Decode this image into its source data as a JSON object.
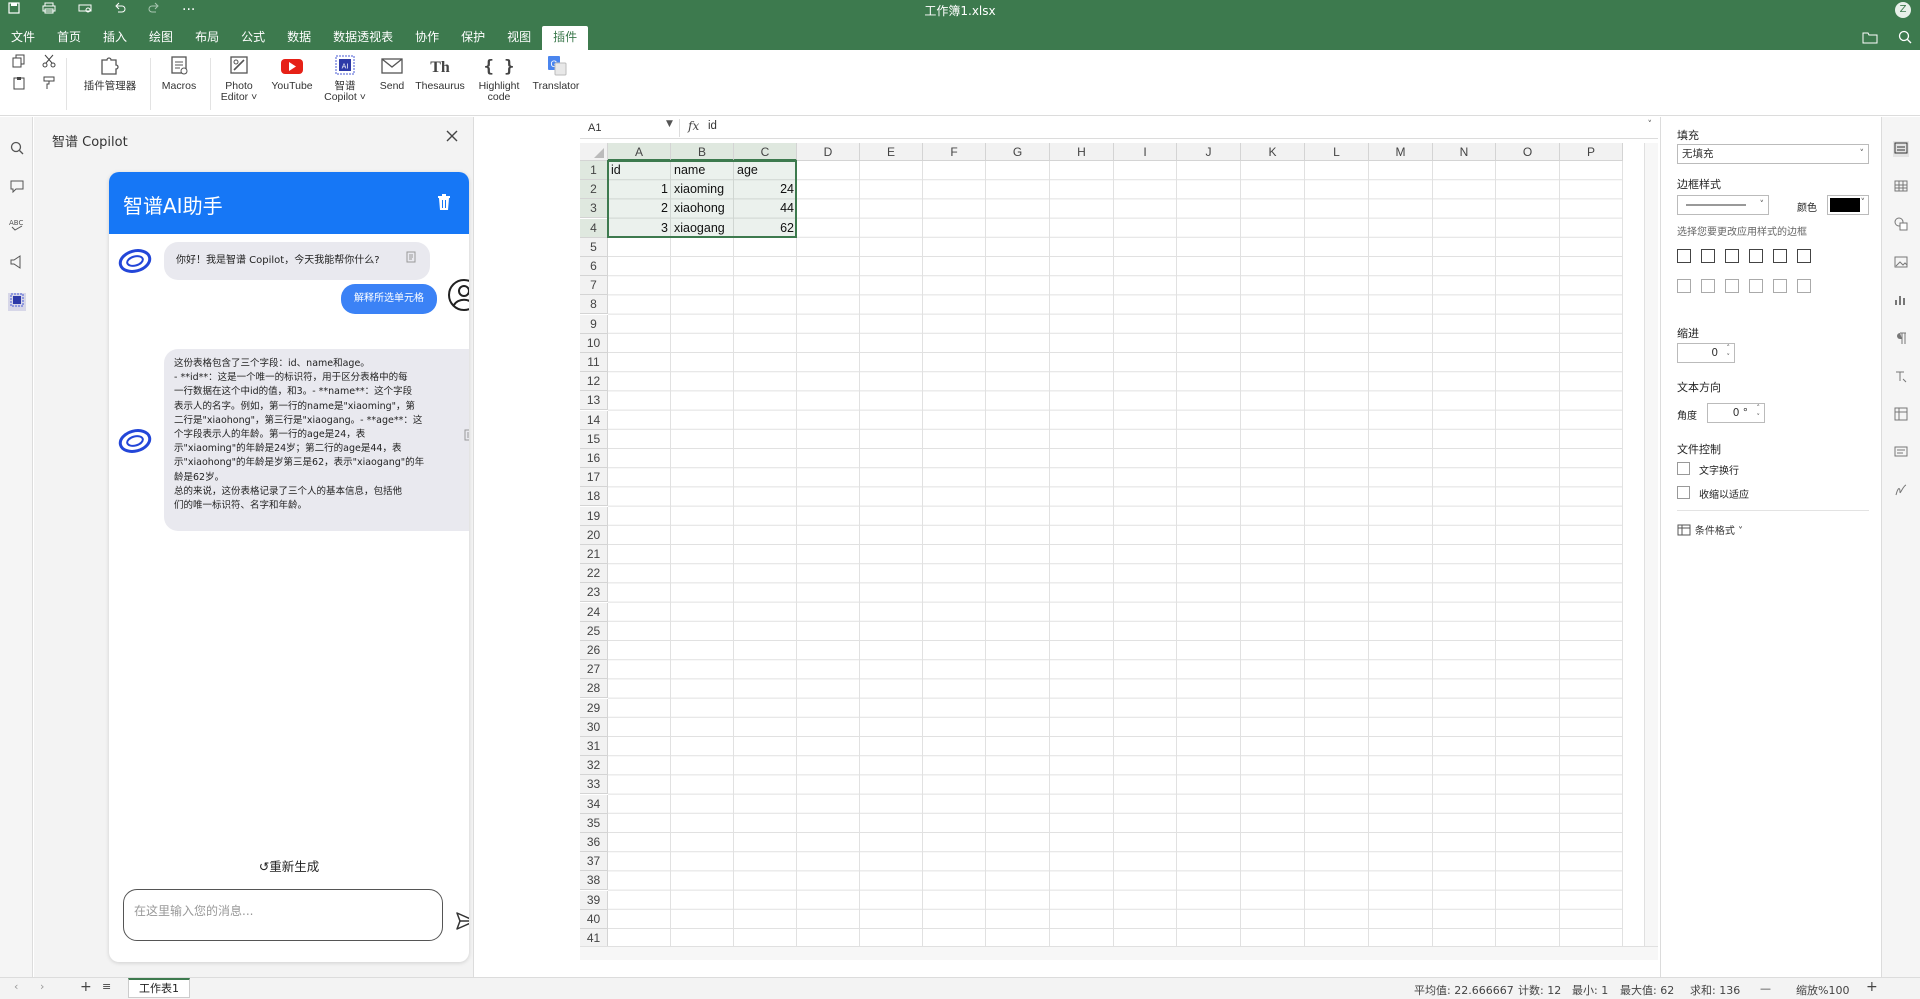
{
  "app": {
    "doc_title": "工作簿1.xlsx",
    "user_initial": "Z",
    "quick_access": [
      "save-icon",
      "print-icon",
      "print-preview-icon",
      "undo-icon",
      "redo-icon",
      "more-icon"
    ],
    "more_label": "···"
  },
  "menu": {
    "items": [
      "文件",
      "首页",
      "插入",
      "绘图",
      "布局",
      "公式",
      "数据",
      "数据透视表",
      "协作",
      "保护",
      "视图",
      "插件"
    ],
    "active": "插件"
  },
  "ribbon": {
    "buttons": [
      {
        "label1": "插件管理器",
        "label2": "",
        "icon": "puzzle-icon"
      },
      {
        "label1": "Macros",
        "label2": "",
        "icon": "macros-icon"
      },
      {
        "label1": "Photo",
        "label2": "Editor ˅",
        "icon": "photo-editor-icon"
      },
      {
        "label1": "YouTube",
        "label2": "",
        "icon": "youtube-icon"
      },
      {
        "label1": "智谱",
        "label2": "Copilot ˅",
        "icon": "ai-chip-icon"
      },
      {
        "label1": "Send",
        "label2": "",
        "icon": "envelope-icon"
      },
      {
        "label1": "Thesaurus",
        "label2": "",
        "icon": "thesaurus-icon"
      },
      {
        "label1": "Highlight",
        "label2": "code",
        "icon": "braces-icon"
      },
      {
        "label1": "Translator",
        "label2": "",
        "icon": "translator-icon"
      }
    ],
    "thesaurus_glyph": "Th",
    "braces_glyph": "{ }",
    "ai_glyph": "AI"
  },
  "copilot": {
    "panel_title": "智谱 Copilot",
    "header_title": "智谱AI助手",
    "greeting": "你好！我是智谱 Copilot，今天我能帮你什么?",
    "user_message": "解释所选单元格",
    "answer": "这份表格包含了三个字段：id、name和age。\n- **id**：这是一个唯一的标识符，用于区分表格中的每\n一行数据在这个中id的值，和3。- **name**：这个字段\n表示人的名字。例如，第一行的name是\"xiaoming\"，第\n二行是\"xiaohong\"，第三行是\"xiaogang。- **age**：这\n个字段表示人的年龄。第一行的age是24，表\n示\"xiaoming\"的年龄是24岁；第二行的age是44，表\n示\"xiaohong\"的年龄是岁第三是62，表示\"xiaogang\"的年\n龄是62岁。\n总的来说，这份表格记录了三个人的基本信息，包括他\n们的唯一标识符、名字和年龄。",
    "regenerate": "↺重新生成",
    "input_placeholder": "在这里输入您的消息..."
  },
  "formula_bar": {
    "cell_ref": "A1",
    "fx_label": "fx",
    "value": "id"
  },
  "sheet": {
    "columns": [
      "A",
      "B",
      "C",
      "D",
      "E",
      "F",
      "G",
      "H",
      "I",
      "J",
      "K",
      "L",
      "M",
      "N",
      "O",
      "P"
    ],
    "row_count": 42,
    "selected_columns": [
      "A",
      "B",
      "C"
    ],
    "selected_rows": [
      1,
      2,
      3,
      4
    ],
    "cells": [
      {
        "row": 1,
        "col": 0,
        "value": "id",
        "num": false
      },
      {
        "row": 1,
        "col": 1,
        "value": "name",
        "num": false
      },
      {
        "row": 1,
        "col": 2,
        "value": "age",
        "num": false
      },
      {
        "row": 2,
        "col": 0,
        "value": "1",
        "num": true
      },
      {
        "row": 2,
        "col": 1,
        "value": "xiaoming",
        "num": false
      },
      {
        "row": 2,
        "col": 2,
        "value": "24",
        "num": true
      },
      {
        "row": 3,
        "col": 0,
        "value": "2",
        "num": true
      },
      {
        "row": 3,
        "col": 1,
        "value": "xiaohong",
        "num": false
      },
      {
        "row": 3,
        "col": 2,
        "value": "44",
        "num": true
      },
      {
        "row": 4,
        "col": 0,
        "value": "3",
        "num": true
      },
      {
        "row": 4,
        "col": 1,
        "value": "xiaogang",
        "num": false
      },
      {
        "row": 4,
        "col": 2,
        "value": "62",
        "num": true
      }
    ]
  },
  "format_panel": {
    "fill_label": "填充",
    "fill_value": "无填充",
    "border_style_label": "边框样式",
    "color_label": "颜色",
    "border_color": "#000000",
    "border_hint": "选择您要更改应用样式的边框",
    "indent_label": "缩进",
    "indent_value": "0",
    "text_dir_label": "文本方向",
    "angle_label": "角度",
    "angle_value": "0 °",
    "text_control_label": "文件控制",
    "wrap_label": "文字换行",
    "shrink_label": "收缩以适应",
    "cond_format_label": "条件格式 ˅"
  },
  "status": {
    "sheet_tab": "工作表1",
    "average": "平均值: 22.666667",
    "count": "计数: 12",
    "min": "最小: 1",
    "max": "最大值: 62",
    "sum": "求和: 136",
    "zoom": "缩放%100",
    "zoom_out": "—",
    "zoom_in": "+"
  },
  "colors": {
    "brand_green": "#3d7a4e",
    "chat_blue": "#1677f6",
    "user_bubble": "#3b82f6"
  }
}
